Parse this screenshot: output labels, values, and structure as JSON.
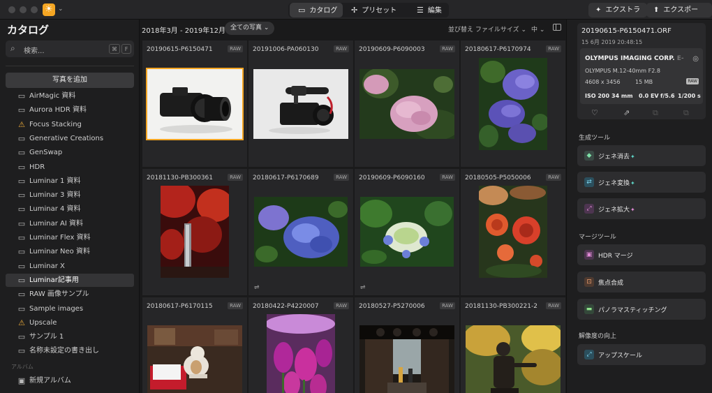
{
  "titlebar": {
    "modes": [
      {
        "icon": "folder-icon",
        "label": "カタログ",
        "active": true
      },
      {
        "icon": "presets-icon",
        "label": "プリセット",
        "active": false
      },
      {
        "icon": "sliders-icon",
        "label": "編集",
        "active": false
      }
    ],
    "extras_label": "エクストラ",
    "export_label": "エクスポート"
  },
  "sidebar": {
    "title": "カタログ",
    "search": {
      "placeholder": "検索...",
      "shortcut_mod": "⌘",
      "shortcut_key": "F"
    },
    "add_photos_label": "写真を追加",
    "folders": [
      {
        "label": "AirMagic 資料",
        "icon": "folder-icon"
      },
      {
        "label": "Aurora HDR 資料",
        "icon": "folder-icon"
      },
      {
        "label": "Focus Stacking",
        "icon": "warning-icon"
      },
      {
        "label": "Generative Creations",
        "icon": "folder-icon"
      },
      {
        "label": "GenSwap",
        "icon": "folder-icon"
      },
      {
        "label": "HDR",
        "icon": "folder-icon"
      },
      {
        "label": "Luminar 1 資料",
        "icon": "folder-icon"
      },
      {
        "label": "Luminar 3 資料",
        "icon": "folder-icon"
      },
      {
        "label": "Luminar 4 資料",
        "icon": "folder-icon"
      },
      {
        "label": "Luminar AI 資料",
        "icon": "folder-icon"
      },
      {
        "label": "Luminar Flex 資料",
        "icon": "folder-icon"
      },
      {
        "label": "Luminar Neo 資料",
        "icon": "folder-icon"
      },
      {
        "label": "Luminar X",
        "icon": "folder-icon"
      },
      {
        "label": "Luminar記事用",
        "icon": "folder-icon",
        "selected": true
      },
      {
        "label": "RAW 画像サンプル",
        "icon": "folder-icon"
      },
      {
        "label": "Sample images",
        "icon": "folder-icon"
      },
      {
        "label": "Upscale",
        "icon": "warning-icon"
      },
      {
        "label": "サンプル 1",
        "icon": "folder-icon"
      },
      {
        "label": "名称未設定の書き出し",
        "icon": "folder-icon"
      }
    ],
    "albums_section": "アルバム",
    "new_album_label": "新規アルバム"
  },
  "grid": {
    "date_range": "2018年3月 - 2019年12月",
    "filter_label": "全ての写真",
    "sort_label": "並び替え ファイルサイズ",
    "size_label": "中",
    "photos": [
      {
        "name": "20190615-P6150471",
        "badge": "RAW",
        "subject": "camera-white",
        "selected": true
      },
      {
        "name": "20191006-PA060130",
        "badge": "RAW",
        "subject": "camera-mic"
      },
      {
        "name": "20190609-P6090003",
        "badge": "RAW",
        "subject": "pink-hydrangea"
      },
      {
        "name": "20180617-P6170974",
        "badge": "RAW",
        "subject": "blue-hydrangea-tall"
      },
      {
        "name": "20181130-PB300361",
        "badge": "RAW",
        "subject": "autumn-waterfall"
      },
      {
        "name": "20180617-P6170689",
        "badge": "RAW",
        "subject": "blue-hydrangea",
        "edited": true
      },
      {
        "name": "20190609-P6090160",
        "badge": "RAW",
        "subject": "white-hydrangea",
        "edited": true
      },
      {
        "name": "20180505-P5050006",
        "badge": "RAW",
        "subject": "red-roses"
      },
      {
        "name": "20180617-P6170115",
        "badge": "RAW",
        "subject": "cat-shop"
      },
      {
        "name": "20180422-P4220007",
        "badge": "RAW",
        "subject": "tulips"
      },
      {
        "name": "20180527-P5270006",
        "badge": "RAW",
        "subject": "street"
      },
      {
        "name": "20181130-PB300221-2",
        "badge": "RAW",
        "subject": "statue"
      }
    ]
  },
  "info": {
    "filename": "20190615-P6150471.ORF",
    "datetime": "15 6月 2019 20:48:15",
    "camera": "OLYMPUS IMAGING CORP.",
    "camera_suffix": "E-",
    "lens": "OLYMPUS M.12-40mm F2.8",
    "dimensions": "4608 x 3456",
    "filesize": "15 MB",
    "raw_badge": "RAW",
    "iso": "ISO 200",
    "focal": "34 mm",
    "ev": "0.0 EV",
    "aperture": "f/5.6",
    "shutter": "1/200 s"
  },
  "tools": {
    "gen_section": "生成ツール",
    "gen_erase": "ジェネ消去",
    "gen_swap": "ジェネ変換",
    "gen_expand": "ジェネ拡大",
    "merge_section": "マージツール",
    "hdr_merge": "HDR マージ",
    "focus_stacking": "焦点合成",
    "panorama": "パノラマスティッチング",
    "resolution_section": "解像度の向上",
    "upscale": "アップスケール",
    "spark_icon": "sparkle-icon"
  }
}
